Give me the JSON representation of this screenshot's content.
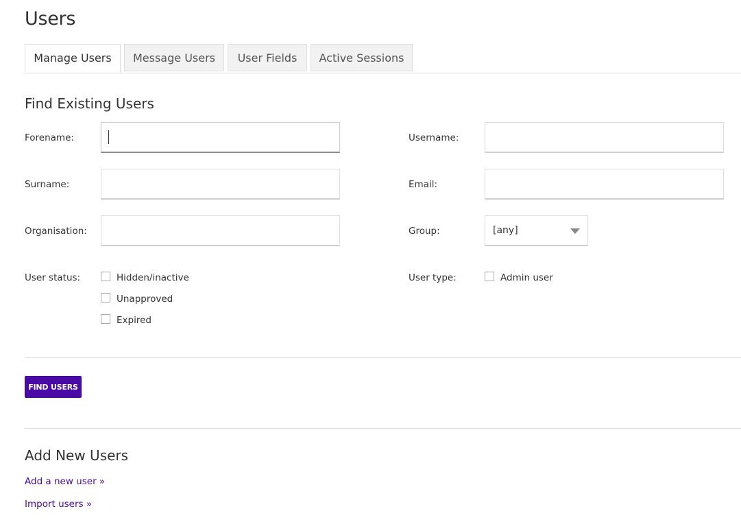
{
  "page": {
    "title": "Users"
  },
  "tabs": [
    {
      "label": "Manage Users",
      "active": true
    },
    {
      "label": "Message Users",
      "active": false
    },
    {
      "label": "User Fields",
      "active": false
    },
    {
      "label": "Active Sessions",
      "active": false
    }
  ],
  "find_section": {
    "title": "Find Existing Users",
    "fields": {
      "forename": {
        "label": "Forename:",
        "value": ""
      },
      "surname": {
        "label": "Surname:",
        "value": ""
      },
      "organisation": {
        "label": "Organisation:",
        "value": ""
      },
      "username": {
        "label": "Username:",
        "value": ""
      },
      "email": {
        "label": "Email:",
        "value": ""
      },
      "group": {
        "label": "Group:",
        "selected": "[any]"
      }
    },
    "user_status": {
      "label": "User status:",
      "options": [
        {
          "label": "Hidden/inactive",
          "checked": false
        },
        {
          "label": "Unapproved",
          "checked": false
        },
        {
          "label": "Expired",
          "checked": false
        }
      ]
    },
    "user_type": {
      "label": "User type:",
      "options": [
        {
          "label": "Admin user",
          "checked": false
        }
      ]
    },
    "submit_label": "FIND USERS"
  },
  "add_section": {
    "title": "Add New Users",
    "links": [
      {
        "label": "Add a new user »"
      },
      {
        "label": "Import users »"
      }
    ]
  },
  "colors": {
    "accent": "#4a0aa5",
    "text": "#333333",
    "border": "#dddddd",
    "tab_inactive_bg": "#f2f2f2"
  },
  "icons": {
    "group_dropdown": "chevron-down-icon",
    "checkbox": "checkbox-unchecked-icon"
  }
}
